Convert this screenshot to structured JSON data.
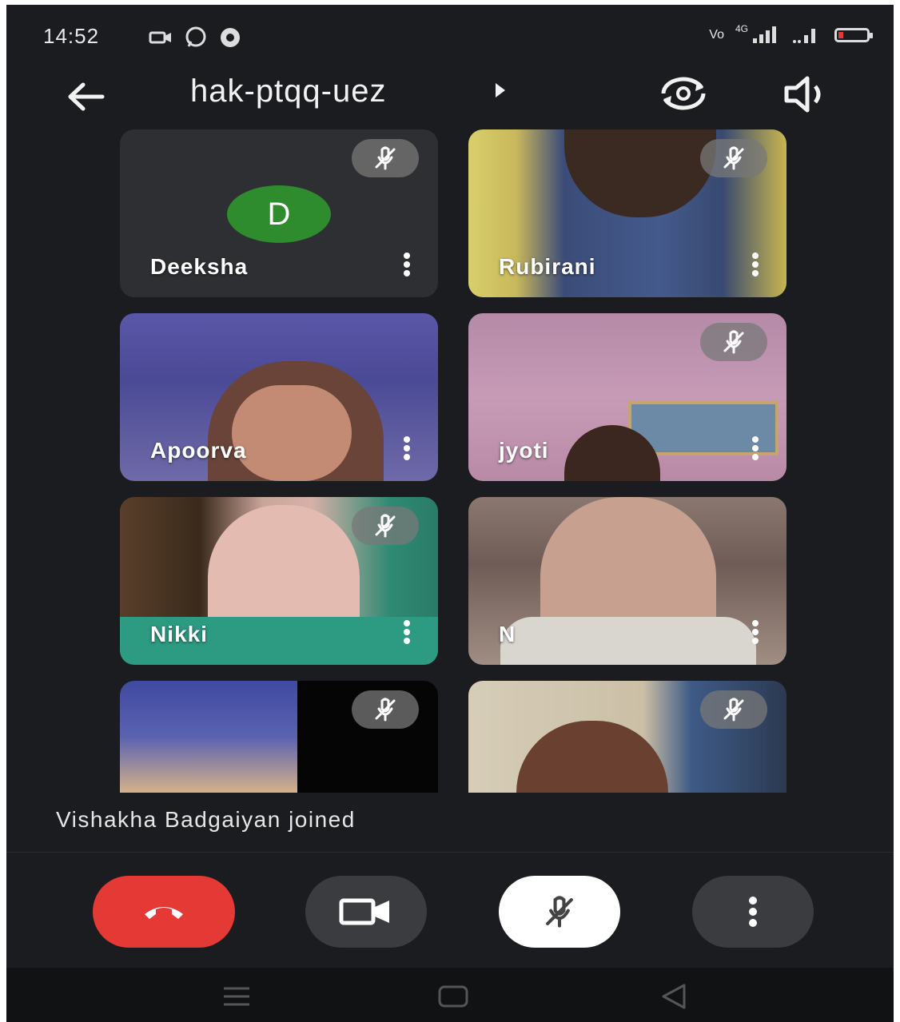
{
  "status_bar": {
    "time": "14:52",
    "left_icons": [
      "video-icon",
      "whatsapp-icon",
      "app-icon"
    ],
    "right_icons": [
      "signal-icon",
      "signal-icon",
      "battery-icon"
    ],
    "network_labels": [
      "Vo",
      "4G"
    ]
  },
  "top_bar": {
    "meeting_code": "hak-ptqq-uez",
    "icons": [
      "back-arrow-icon",
      "caret-right-icon",
      "switch-camera-icon",
      "speaker-icon"
    ]
  },
  "participants": [
    {
      "name": "Deeksha",
      "avatar_letter": "D",
      "muted": true,
      "video": false
    },
    {
      "name": "Rubirani",
      "muted": true,
      "video": true
    },
    {
      "name": "Apoorva",
      "muted": false,
      "video": true
    },
    {
      "name": "jyoti",
      "muted": true,
      "video": true
    },
    {
      "name": "Nikki",
      "muted": true,
      "video": true
    },
    {
      "name": "N",
      "muted": false,
      "video": true
    },
    {
      "name": "",
      "muted": true,
      "video": true
    },
    {
      "name": "",
      "muted": true,
      "video": true
    }
  ],
  "notification": {
    "text": "Vishakha Badgaiyan joined"
  },
  "controls": {
    "items": [
      "end-call-icon",
      "video-camera-icon",
      "mic-off-icon",
      "more-vert-icon"
    ]
  },
  "colors": {
    "background": "#1b1c1f",
    "end_call": "#e53935",
    "avatar": "#2e8b2e",
    "control_dark": "#3b3c40"
  }
}
